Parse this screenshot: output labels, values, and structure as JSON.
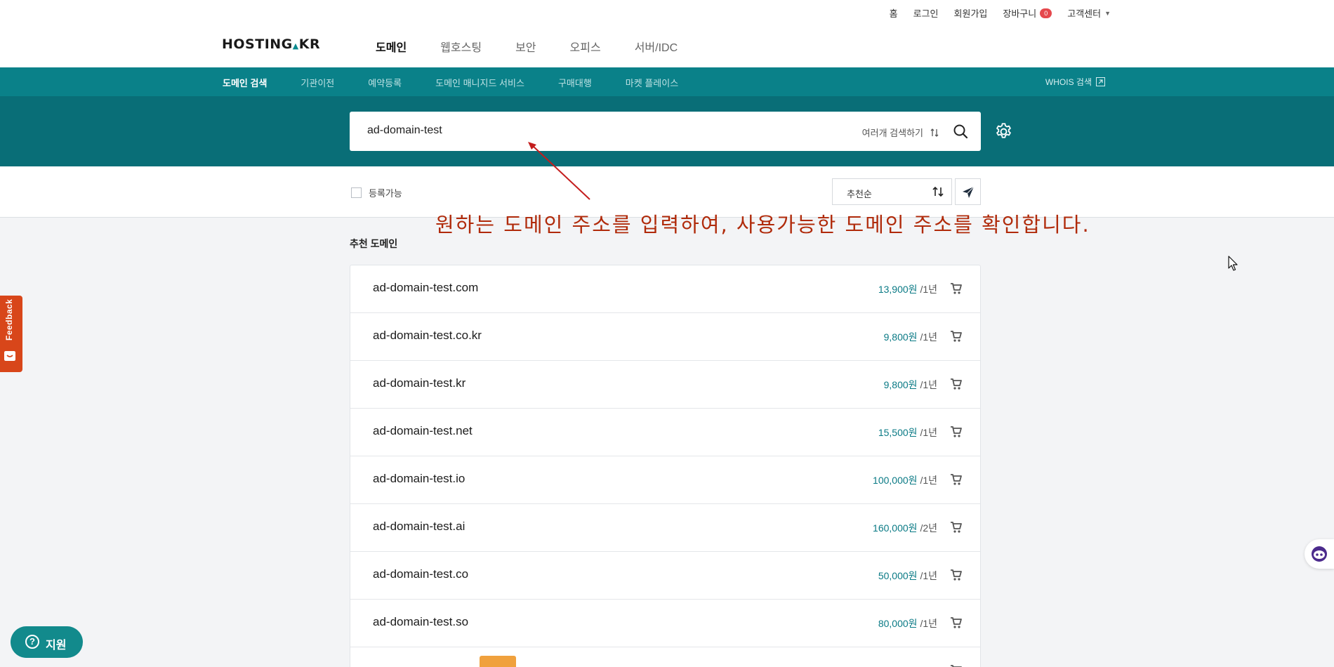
{
  "util_nav": {
    "home": "홈",
    "login": "로그인",
    "signup": "회원가입",
    "cart": "장바구니",
    "cart_count": "0",
    "support_center": "고객센터"
  },
  "brand": {
    "logo_pre": "HOSTING",
    "logo_post": "KR"
  },
  "main_nav": [
    "도메인",
    "웹호스팅",
    "보안",
    "오피스",
    "서버/IDC"
  ],
  "sub_nav": [
    "도메인 검색",
    "기관이전",
    "예약등록",
    "도메인 매니지드 서비스",
    "구매대행",
    "마켓 플레이스"
  ],
  "whois_label": "WHOIS 검색",
  "search": {
    "value": "ad-domain-test",
    "multi_label": "여러개 검색하기"
  },
  "filter": {
    "available_label": "등록가능",
    "sort_label": "추천순"
  },
  "annotation_text": "원하는 도메인 주소를 입력하여, 사용가능한 도메인 주소를 확인합니다.",
  "results_title": "추천 도메인",
  "results": [
    {
      "domain": "ad-domain-test.com",
      "price": "13,900원",
      "period": "/1년"
    },
    {
      "domain": "ad-domain-test.co.kr",
      "price": "9,800원",
      "period": "/1년"
    },
    {
      "domain": "ad-domain-test.kr",
      "price": "9,800원",
      "period": "/1년"
    },
    {
      "domain": "ad-domain-test.net",
      "price": "15,500원",
      "period": "/1년"
    },
    {
      "domain": "ad-domain-test.io",
      "price": "100,000원",
      "period": "/1년"
    },
    {
      "domain": "ad-domain-test.ai",
      "price": "160,000원",
      "period": "/2년"
    },
    {
      "domain": "ad-domain-test.co",
      "price": "50,000원",
      "period": "/1년"
    },
    {
      "domain": "ad-domain-test.so",
      "price": "80,000원",
      "period": "/1년"
    },
    {
      "domain": "",
      "price": "",
      "period": ""
    }
  ],
  "feedback_label": "Feedback",
  "support_label": "지원",
  "colors": {
    "primary": "#0a8189",
    "search_band": "#096e77",
    "annotation": "#b02a0a",
    "price": "#0a7a85",
    "feedback": "#d8461a"
  },
  "icons": [
    "search-icon",
    "gear-icon",
    "sort-icon",
    "send-icon",
    "cart-icon",
    "external-link-icon",
    "chat-bot-icon",
    "question-icon",
    "mouse-cursor-icon"
  ]
}
